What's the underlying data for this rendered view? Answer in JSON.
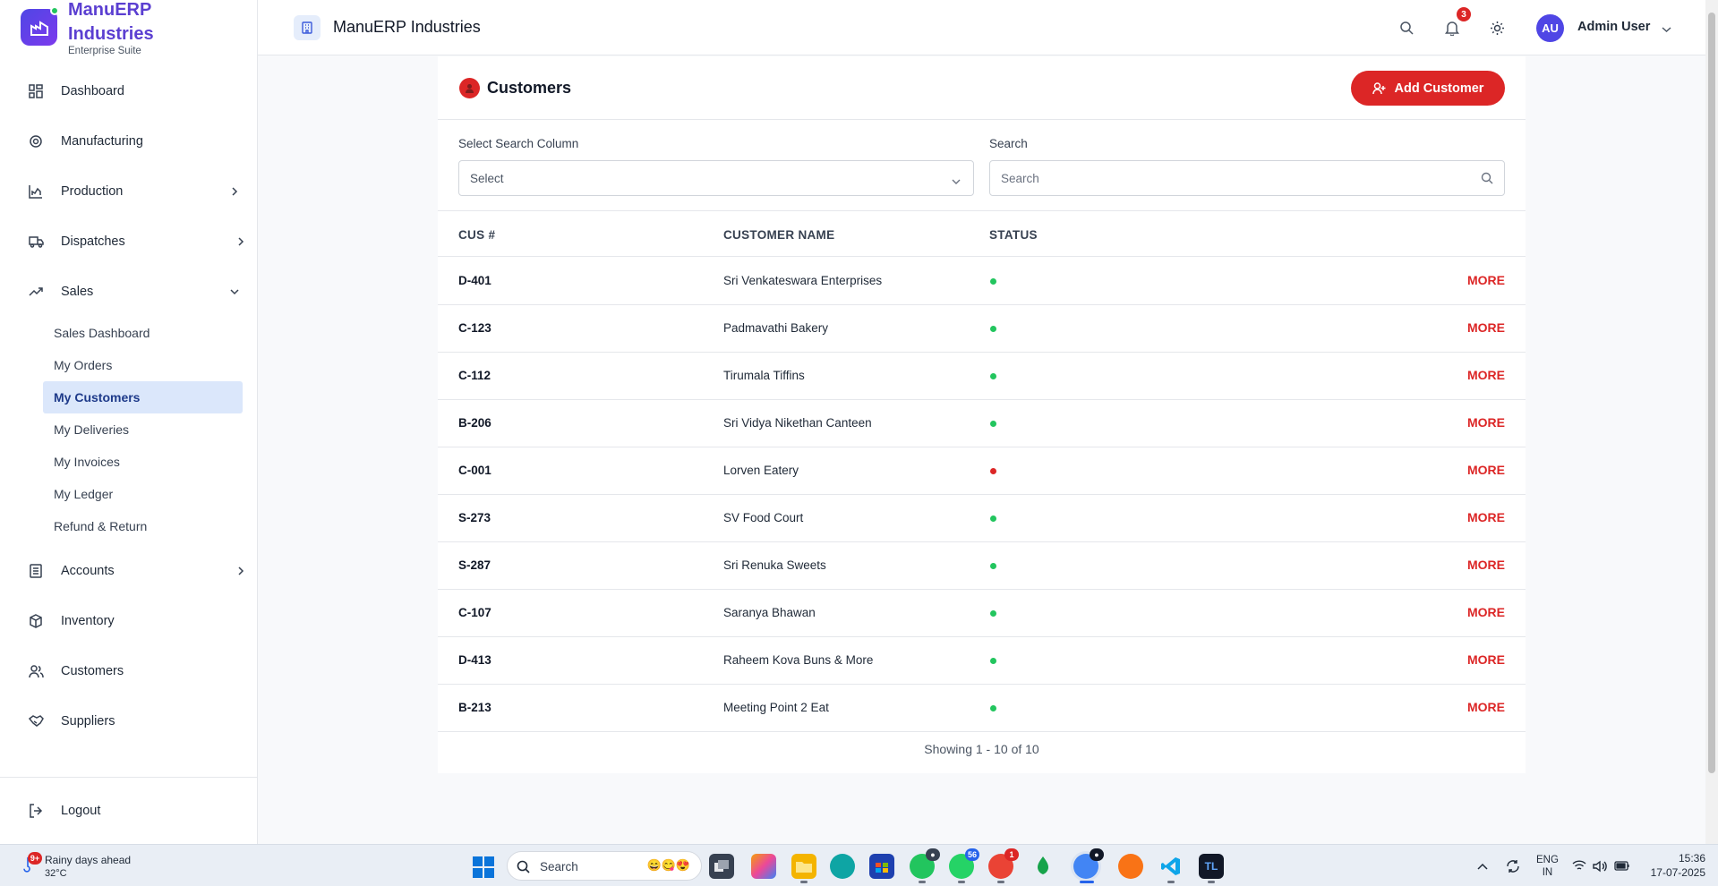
{
  "brand": {
    "name": "ManuERP Industries",
    "subtitle": "Enterprise Suite"
  },
  "sidebar": {
    "items": [
      {
        "label": "Dashboard",
        "icon": "grid-icon"
      },
      {
        "label": "Manufacturing",
        "icon": "gear-icon"
      },
      {
        "label": "Production",
        "icon": "bar-chart-icon",
        "chevron": "right"
      },
      {
        "label": "Dispatches",
        "icon": "truck-icon",
        "chevron": "right"
      },
      {
        "label": "Sales",
        "icon": "trending-up-icon",
        "chevron": "down"
      },
      {
        "label": "Accounts",
        "icon": "ledger-icon",
        "chevron": "right"
      },
      {
        "label": "Inventory",
        "icon": "box-icon"
      },
      {
        "label": "Customers",
        "icon": "users-icon"
      },
      {
        "label": "Suppliers",
        "icon": "handshake-icon"
      }
    ],
    "sales_sub": [
      {
        "label": "Sales Dashboard"
      },
      {
        "label": "My Orders"
      },
      {
        "label": "My Customers",
        "active": true
      },
      {
        "label": "My Deliveries"
      },
      {
        "label": "My Invoices"
      },
      {
        "label": "My Ledger"
      },
      {
        "label": "Refund & Return"
      }
    ],
    "logout": "Logout"
  },
  "header": {
    "title": "ManuERP Industries",
    "notification_count": "3",
    "user_initials": "AU",
    "user_name": "Admin User"
  },
  "page": {
    "title": "Customers",
    "add_button": "Add Customer",
    "search_column_label": "Select Search Column",
    "search_column_value": "Select",
    "search_label": "Search",
    "search_placeholder": "Search",
    "columns": [
      "CUS #",
      "CUSTOMER NAME",
      "STATUS"
    ],
    "more_label": "MORE",
    "rows": [
      {
        "id": "D-401",
        "name": "Sri Venkateswara Enterprises",
        "status": "active"
      },
      {
        "id": "C-123",
        "name": "Padmavathi Bakery",
        "status": "active"
      },
      {
        "id": "C-112",
        "name": "Tirumala Tiffins",
        "status": "active"
      },
      {
        "id": "B-206",
        "name": "Sri Vidya Nikethan Canteen",
        "status": "active"
      },
      {
        "id": "C-001",
        "name": "Lorven Eatery",
        "status": "inactive"
      },
      {
        "id": "S-273",
        "name": "SV Food Court",
        "status": "active"
      },
      {
        "id": "S-287",
        "name": "Sri Renuka Sweets",
        "status": "active"
      },
      {
        "id": "C-107",
        "name": "Saranya Bhawan",
        "status": "active"
      },
      {
        "id": "D-413",
        "name": "Raheem Kova Buns & More",
        "status": "active"
      },
      {
        "id": "B-213",
        "name": "Meeting Point 2 Eat",
        "status": "active"
      }
    ],
    "pagination": "Showing 1 - 10 of 10"
  },
  "colors": {
    "accent": "#dc2626",
    "brand": "#5b3fd1",
    "active_status": "#22c55e",
    "inactive_status": "#dc2626",
    "active_nav_bg": "#dbe7fb"
  },
  "taskbar": {
    "weather_badge": "9+",
    "weather_text": "Rainy days ahead",
    "temperature": "32°C",
    "search_text": "Search",
    "badges": {
      "whatsapp": "56",
      "chrome": "1"
    },
    "lang_line1": "ENG",
    "lang_line2": "IN",
    "time": "15:36",
    "date": "17-07-2025"
  }
}
